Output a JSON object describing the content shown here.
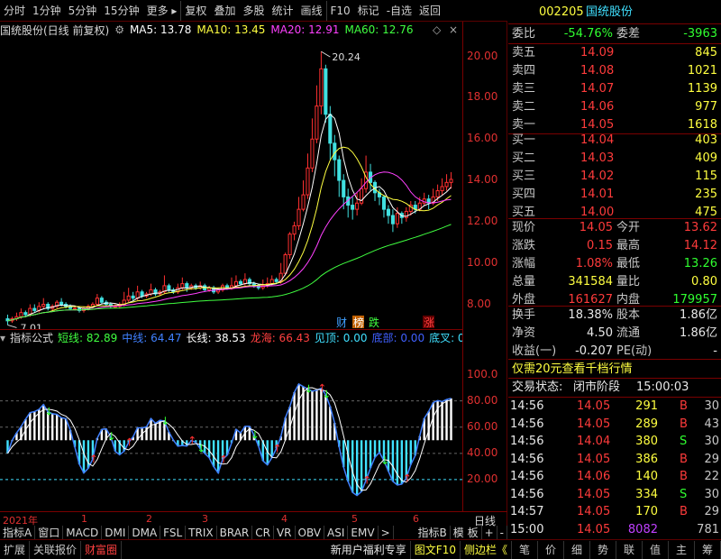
{
  "toolbar": {
    "items": [
      "分时",
      "1分钟",
      "5分钟",
      "15分钟",
      "更多",
      "复权",
      "叠加",
      "多股",
      "统计",
      "画线",
      "F10",
      "标记",
      "-自选",
      "返回"
    ]
  },
  "kline_legend": {
    "title": "国统股份(日线 前复权)",
    "ma5": "MA5: 13.78",
    "ma10": "MA10: 13.45",
    "ma20": "MA20: 12.91",
    "ma60": "MA60: 12.76",
    "colors": {
      "ma5": "#ffffff",
      "ma10": "#ffff40",
      "ma20": "#ff40ff",
      "ma60": "#40ff40"
    }
  },
  "chart_data": [
    {
      "type": "candlestick",
      "y_ticks": [
        "20.00",
        "18.00",
        "16.00",
        "14.00",
        "12.00",
        "10.00",
        "8.00"
      ],
      "ylim": [
        6.8,
        20.9
      ],
      "annotations": {
        "high": "20.24",
        "low": "7.01"
      },
      "markers": [
        "财",
        "榜",
        "跌",
        "涨"
      ],
      "candles": [
        [
          7.3,
          7.2,
          7.5,
          7.0
        ],
        [
          7.2,
          7.3,
          7.4,
          7.1
        ],
        [
          7.3,
          7.4,
          7.6,
          7.2
        ],
        [
          7.4,
          7.6,
          7.8,
          7.3
        ],
        [
          7.6,
          7.5,
          7.7,
          7.4
        ],
        [
          7.5,
          7.8,
          8.0,
          7.4
        ],
        [
          7.8,
          7.7,
          8.0,
          7.6
        ],
        [
          7.7,
          7.9,
          8.1,
          7.6
        ],
        [
          7.9,
          8.0,
          8.3,
          7.8
        ],
        [
          8.0,
          7.8,
          8.1,
          7.7
        ],
        [
          7.8,
          7.9,
          8.0,
          7.7
        ],
        [
          7.9,
          8.1,
          8.2,
          7.8
        ],
        [
          8.1,
          8.0,
          8.3,
          7.9
        ],
        [
          8.0,
          7.9,
          8.1,
          7.8
        ],
        [
          7.9,
          7.8,
          8.0,
          7.7
        ],
        [
          7.8,
          7.8,
          7.9,
          7.7
        ],
        [
          7.8,
          7.7,
          7.9,
          7.6
        ],
        [
          7.7,
          7.8,
          7.9,
          7.6
        ],
        [
          7.8,
          7.9,
          8.0,
          7.7
        ],
        [
          7.9,
          8.0,
          8.1,
          7.8
        ],
        [
          8.0,
          8.3,
          8.5,
          7.9
        ],
        [
          8.3,
          8.1,
          8.4,
          8.0
        ],
        [
          8.1,
          8.0,
          8.2,
          7.9
        ],
        [
          8.0,
          7.9,
          8.1,
          7.8
        ],
        [
          7.9,
          7.9,
          8.0,
          7.8
        ],
        [
          7.9,
          8.0,
          8.1,
          7.8
        ],
        [
          8.0,
          8.2,
          8.6,
          7.9
        ],
        [
          8.2,
          8.4,
          8.8,
          8.1
        ],
        [
          8.4,
          8.3,
          8.6,
          8.2
        ],
        [
          8.3,
          8.6,
          8.9,
          8.2
        ],
        [
          8.6,
          8.4,
          8.7,
          8.3
        ],
        [
          8.4,
          8.5,
          8.6,
          8.3
        ],
        [
          8.5,
          8.7,
          9.0,
          8.4
        ],
        [
          8.7,
          8.5,
          8.8,
          8.4
        ],
        [
          8.5,
          8.6,
          8.7,
          8.4
        ],
        [
          8.6,
          8.9,
          9.4,
          8.5
        ],
        [
          8.9,
          8.7,
          9.0,
          8.6
        ],
        [
          8.7,
          8.6,
          8.8,
          8.5
        ],
        [
          8.6,
          8.8,
          9.0,
          8.5
        ],
        [
          8.8,
          9.0,
          9.3,
          8.7
        ],
        [
          9.0,
          8.8,
          9.1,
          8.6
        ],
        [
          8.8,
          8.9,
          9.0,
          8.7
        ],
        [
          8.9,
          8.8,
          9.0,
          8.7
        ],
        [
          8.8,
          8.9,
          9.1,
          8.7
        ],
        [
          8.9,
          8.7,
          9.0,
          8.6
        ],
        [
          8.7,
          8.8,
          8.9,
          8.6
        ],
        [
          8.8,
          8.6,
          8.9,
          8.5
        ],
        [
          8.6,
          8.7,
          8.8,
          8.5
        ],
        [
          8.7,
          8.9,
          9.0,
          8.6
        ],
        [
          8.9,
          8.8,
          9.0,
          8.7
        ],
        [
          8.8,
          8.9,
          9.3,
          8.7
        ],
        [
          8.9,
          9.1,
          9.4,
          8.8
        ],
        [
          9.1,
          9.0,
          9.2,
          8.9
        ],
        [
          9.0,
          9.2,
          9.5,
          8.9
        ],
        [
          9.2,
          9.0,
          9.3,
          8.9
        ],
        [
          9.0,
          8.9,
          9.1,
          8.8
        ],
        [
          8.9,
          8.8,
          9.0,
          8.7
        ],
        [
          8.8,
          8.9,
          9.2,
          8.7
        ],
        [
          8.9,
          9.0,
          9.3,
          8.8
        ],
        [
          9.0,
          9.2,
          9.4,
          8.9
        ],
        [
          9.2,
          9.1,
          9.3,
          9.0
        ],
        [
          9.1,
          9.5,
          10.0,
          9.0
        ],
        [
          9.5,
          10.4,
          10.5,
          9.4
        ],
        [
          10.4,
          11.4,
          11.5,
          10.2
        ],
        [
          11.4,
          11.8,
          12.0,
          11.1
        ],
        [
          11.8,
          12.6,
          13.2,
          11.6
        ],
        [
          12.6,
          13.3,
          14.0,
          12.5
        ],
        [
          13.3,
          14.6,
          15.3,
          13.1
        ],
        [
          14.6,
          16.0,
          17.0,
          14.4
        ],
        [
          16.0,
          17.6,
          18.6,
          15.8
        ],
        [
          17.6,
          19.4,
          20.24,
          17.2
        ],
        [
          19.4,
          17.2,
          19.6,
          16.8
        ],
        [
          17.2,
          15.8,
          17.6,
          15.0
        ],
        [
          15.8,
          15.0,
          16.2,
          14.2
        ],
        [
          15.0,
          14.0,
          15.2,
          13.2
        ],
        [
          14.0,
          13.2,
          14.3,
          12.6
        ],
        [
          13.2,
          12.8,
          13.6,
          12.2
        ],
        [
          12.8,
          12.6,
          13.2,
          12.1
        ],
        [
          12.6,
          12.9,
          13.4,
          12.3
        ],
        [
          12.9,
          13.6,
          14.1,
          12.8
        ],
        [
          13.6,
          14.4,
          15.2,
          13.4
        ],
        [
          14.4,
          13.9,
          14.8,
          13.5
        ],
        [
          13.9,
          13.4,
          14.0,
          13.0
        ],
        [
          13.4,
          13.2,
          13.6,
          12.8
        ],
        [
          13.2,
          12.6,
          13.3,
          12.2
        ],
        [
          12.6,
          12.3,
          12.8,
          11.9
        ],
        [
          12.3,
          11.9,
          12.6,
          11.5
        ],
        [
          11.9,
          12.4,
          12.7,
          11.7
        ],
        [
          12.4,
          12.2,
          12.5,
          11.9
        ],
        [
          12.2,
          12.5,
          12.7,
          12.0
        ],
        [
          12.5,
          12.8,
          13.0,
          12.3
        ],
        [
          12.8,
          12.6,
          13.0,
          12.4
        ],
        [
          12.6,
          12.9,
          13.2,
          12.5
        ],
        [
          12.9,
          13.1,
          13.4,
          12.8
        ],
        [
          13.1,
          12.9,
          13.3,
          12.6
        ],
        [
          12.9,
          13.2,
          13.6,
          12.8
        ],
        [
          13.2,
          13.5,
          13.8,
          13.0
        ],
        [
          13.5,
          13.7,
          14.1,
          13.3
        ],
        [
          13.7,
          13.9,
          14.3,
          13.5
        ],
        [
          13.9,
          14.05,
          14.4,
          13.6
        ]
      ]
    }
  ],
  "indicator_legend": {
    "title": "指标公式",
    "short": "短线: 82.89",
    "mid": "中线: 64.47",
    "long": "长线: 38.53",
    "dragon": "龙海: 66.43",
    "top": "见顶: 0.00",
    "bottom": "底部: 0.00",
    "bottom_fork": "底叉: 0.00",
    "colors": {
      "short": "#40ff40",
      "mid": "#4080ff",
      "long": "#ffffff",
      "dragon": "#ff4040",
      "top": "#40e0ff",
      "bottom": "#4060ff",
      "bottom_fork": "#40e0ff"
    }
  },
  "indicator_axis": [
    "100.0",
    "80.00",
    "60.00",
    "40.00",
    "20.00"
  ],
  "date_axis": {
    "year": "2021年",
    "months": [
      "1",
      "2",
      "3",
      "4",
      "5",
      "6"
    ],
    "right_label": "日线"
  },
  "tabs": [
    "指标A",
    "窗口",
    "MACD",
    "DMI",
    "DMA",
    "FSL",
    "TRIX",
    "BRAR",
    "CR",
    "VR",
    "OBV",
    "ASI",
    "EMV"
  ],
  "tabs_right": [
    "指标B",
    "模 板",
    "+",
    "-"
  ],
  "bottombar": {
    "left": [
      "扩展",
      "关联报价",
      "财富圈"
    ],
    "promo": "新用户福利专享",
    "graph": "图文F10",
    "sidebar": "侧边栏《",
    "right": [
      "笔",
      "价",
      "细",
      "势",
      "联",
      "值",
      "主",
      "筹"
    ]
  },
  "quote": {
    "code": "002205",
    "name": "国统股份",
    "wei_bi_label": "委比",
    "wei_bi": "-54.76%",
    "wei_cha_label": "委差",
    "wei_cha": "-3963",
    "asks": [
      {
        "label": "卖五",
        "price": "14.09",
        "vol": "845"
      },
      {
        "label": "卖四",
        "price": "14.08",
        "vol": "1021"
      },
      {
        "label": "卖三",
        "price": "14.07",
        "vol": "1139"
      },
      {
        "label": "卖二",
        "price": "14.06",
        "vol": "977"
      },
      {
        "label": "卖一",
        "price": "14.05",
        "vol": "1618"
      }
    ],
    "bids": [
      {
        "label": "买一",
        "price": "14.04",
        "vol": "403"
      },
      {
        "label": "买二",
        "price": "14.03",
        "vol": "409"
      },
      {
        "label": "买三",
        "price": "14.02",
        "vol": "115"
      },
      {
        "label": "买四",
        "price": "14.01",
        "vol": "235"
      },
      {
        "label": "买五",
        "price": "14.00",
        "vol": "475"
      }
    ],
    "stats": [
      {
        "l1": "现价",
        "v1": "14.05",
        "l2": "今开",
        "v2": "13.62",
        "c1": "red",
        "c2": "red"
      },
      {
        "l1": "涨跌",
        "v1": "0.15",
        "l2": "最高",
        "v2": "14.12",
        "c1": "red",
        "c2": "red"
      },
      {
        "l1": "涨幅",
        "v1": "1.08%",
        "l2": "最低",
        "v2": "13.26",
        "c1": "red",
        "c2": "green"
      },
      {
        "l1": "总量",
        "v1": "341584",
        "l2": "量比",
        "v2": "0.80",
        "c1": "yellow",
        "c2": "yellow"
      },
      {
        "l1": "外盘",
        "v1": "161627",
        "l2": "内盘",
        "v2": "179957",
        "c1": "red",
        "c2": "green"
      }
    ],
    "stats2": [
      {
        "l1": "换手",
        "v1": "18.38%",
        "l2": "股本",
        "v2": "1.86亿",
        "c1": "white",
        "c2": "white"
      },
      {
        "l1": "净资",
        "v1": "4.50",
        "l2": "流通",
        "v2": "1.86亿",
        "c1": "white",
        "c2": "white"
      },
      {
        "l1": "收益(一)",
        "v1": "-0.207",
        "l2": "PE(动)",
        "v2": "-",
        "c1": "white",
        "c2": "white"
      }
    ],
    "promo": "仅需20元查看千档行情",
    "status_label": "交易状态:",
    "status": "闭市阶段",
    "status_time": "15:00:03",
    "ticks": [
      {
        "t": "14:56",
        "p": "14.05",
        "v": "291",
        "s": "B",
        "n": "30"
      },
      {
        "t": "14:56",
        "p": "14.05",
        "v": "289",
        "s": "B",
        "n": "43"
      },
      {
        "t": "14:56",
        "p": "14.04",
        "v": "380",
        "s": "S",
        "n": "30"
      },
      {
        "t": "14:56",
        "p": "14.05",
        "v": "386",
        "s": "B",
        "n": "29"
      },
      {
        "t": "14:56",
        "p": "14.06",
        "v": "140",
        "s": "B",
        "n": "22"
      },
      {
        "t": "14:56",
        "p": "14.05",
        "v": "334",
        "s": "S",
        "n": "30"
      },
      {
        "t": "14:57",
        "p": "14.05",
        "v": "170",
        "s": "B",
        "n": "29"
      },
      {
        "t": "15:00",
        "p": "14.05",
        "v": "8082",
        "s": "",
        "n": "781"
      }
    ]
  }
}
